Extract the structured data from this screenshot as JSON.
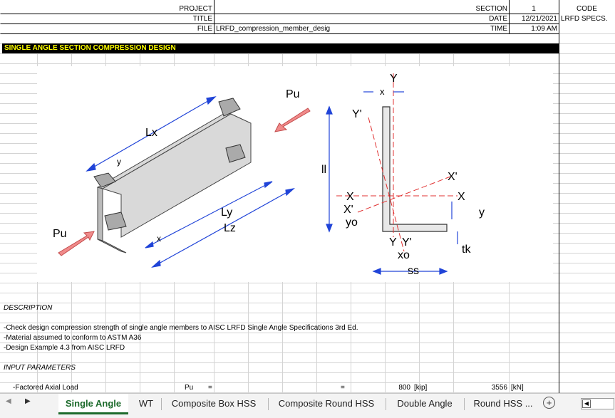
{
  "header": {
    "project_label": "PROJECT",
    "title_label": "TITLE",
    "file_label": "FILE",
    "file_value": "LRFD_compression_member_desig",
    "section_label": "SECTION",
    "section_value": "1",
    "date_label": "DATE",
    "date_value": "12/21/2021",
    "time_label": "TIME",
    "time_value": "1:09 AM",
    "code_label": "CODE",
    "code_value": "LRFD SPECS."
  },
  "banner": {
    "title": "SINGLE ANGLE SECTION COMPRESSION DESIGN"
  },
  "figure": {
    "pu_left": "Pu",
    "pu_right": "Pu",
    "lx": "Lx",
    "ly": "Ly",
    "lz": "Lz",
    "y_small": "y",
    "x_small": "x",
    "sec_x_top": "x",
    "sec_Y_top": "Y",
    "sec_Y_prime_left": "Y'",
    "sec_ll": "ll",
    "sec_X_prime_right": "X'",
    "sec_X_left": "X",
    "sec_X_right": "X",
    "sec_X_prime_left": "X'",
    "sec_yo": "yo",
    "sec_y_right": "y",
    "sec_Y_bottom": "Y",
    "sec_Y_prime_bottom": "Y'",
    "sec_xo": "xo",
    "sec_tk": "tk",
    "sec_ss": "ss"
  },
  "description": {
    "heading": "DESCRIPTION",
    "lines": [
      "-Check design compression strength of single angle members to AISC LRFD Single Angle Specifications 3rd Ed.",
      "-Material assumed to conform to ASTM A36",
      "-Design Example 4.3 from AISC LRFD"
    ]
  },
  "inputs": {
    "heading": "INPUT PARAMETERS",
    "row1": {
      "label": "-Factored Axial Load",
      "symbol": "Pu",
      "eq1": "=",
      "eq2": "=",
      "value": "800",
      "unit": "[kip]",
      "value_si": "3556",
      "unit_si": "[kN]"
    }
  },
  "tabs": {
    "items": [
      "Single Angle",
      "WT",
      "Composite Box HSS",
      "Composite Round HSS",
      "Double Angle",
      "Round HSS ..."
    ],
    "active": "Single Angle",
    "add": "+"
  }
}
